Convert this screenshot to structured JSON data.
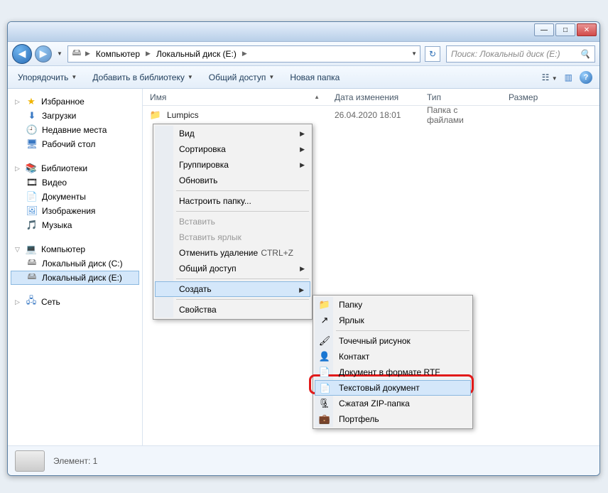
{
  "titlebar": {
    "min": "—",
    "max": "□",
    "close": "✕"
  },
  "breadcrumb": {
    "computer": "Компьютер",
    "disk": "Локальный диск (E:)"
  },
  "search": {
    "placeholder": "Поиск: Локальный диск (E:)"
  },
  "toolbar": {
    "arrange": "Упорядочить",
    "add_lib": "Добавить в библиотеку",
    "share": "Общий доступ",
    "new_folder": "Новая папка"
  },
  "sidebar": {
    "fav_header": "Избранное",
    "fav": [
      "Загрузки",
      "Недавние места",
      "Рабочий стол"
    ],
    "lib_header": "Библиотеки",
    "lib": [
      "Видео",
      "Документы",
      "Изображения",
      "Музыка"
    ],
    "comp_header": "Компьютер",
    "comp": [
      "Локальный диск (C:)",
      "Локальный диск (E:)"
    ],
    "net": "Сеть"
  },
  "columns": {
    "name": "Имя",
    "date": "Дата изменения",
    "type": "Тип",
    "size": "Размер"
  },
  "files": [
    {
      "name": "Lumpics",
      "date": "26.04.2020 18:01",
      "type": "Папка с файлами"
    }
  ],
  "status": {
    "label": "Элемент: 1"
  },
  "ctx1": {
    "view": "Вид",
    "sort": "Сортировка",
    "group": "Группировка",
    "refresh": "Обновить",
    "customize": "Настроить папку...",
    "paste": "Вставить",
    "paste_link": "Вставить ярлык",
    "undo": "Отменить удаление",
    "undo_sc": "CTRL+Z",
    "share": "Общий доступ",
    "create": "Создать",
    "props": "Свойства"
  },
  "ctx2": {
    "folder": "Папку",
    "shortcut": "Ярлык",
    "bitmap": "Точечный рисунок",
    "contact": "Контакт",
    "rtf": "Документ в формате RTF",
    "txt": "Текстовый документ",
    "zip": "Сжатая ZIP-папка",
    "brief": "Портфель"
  }
}
